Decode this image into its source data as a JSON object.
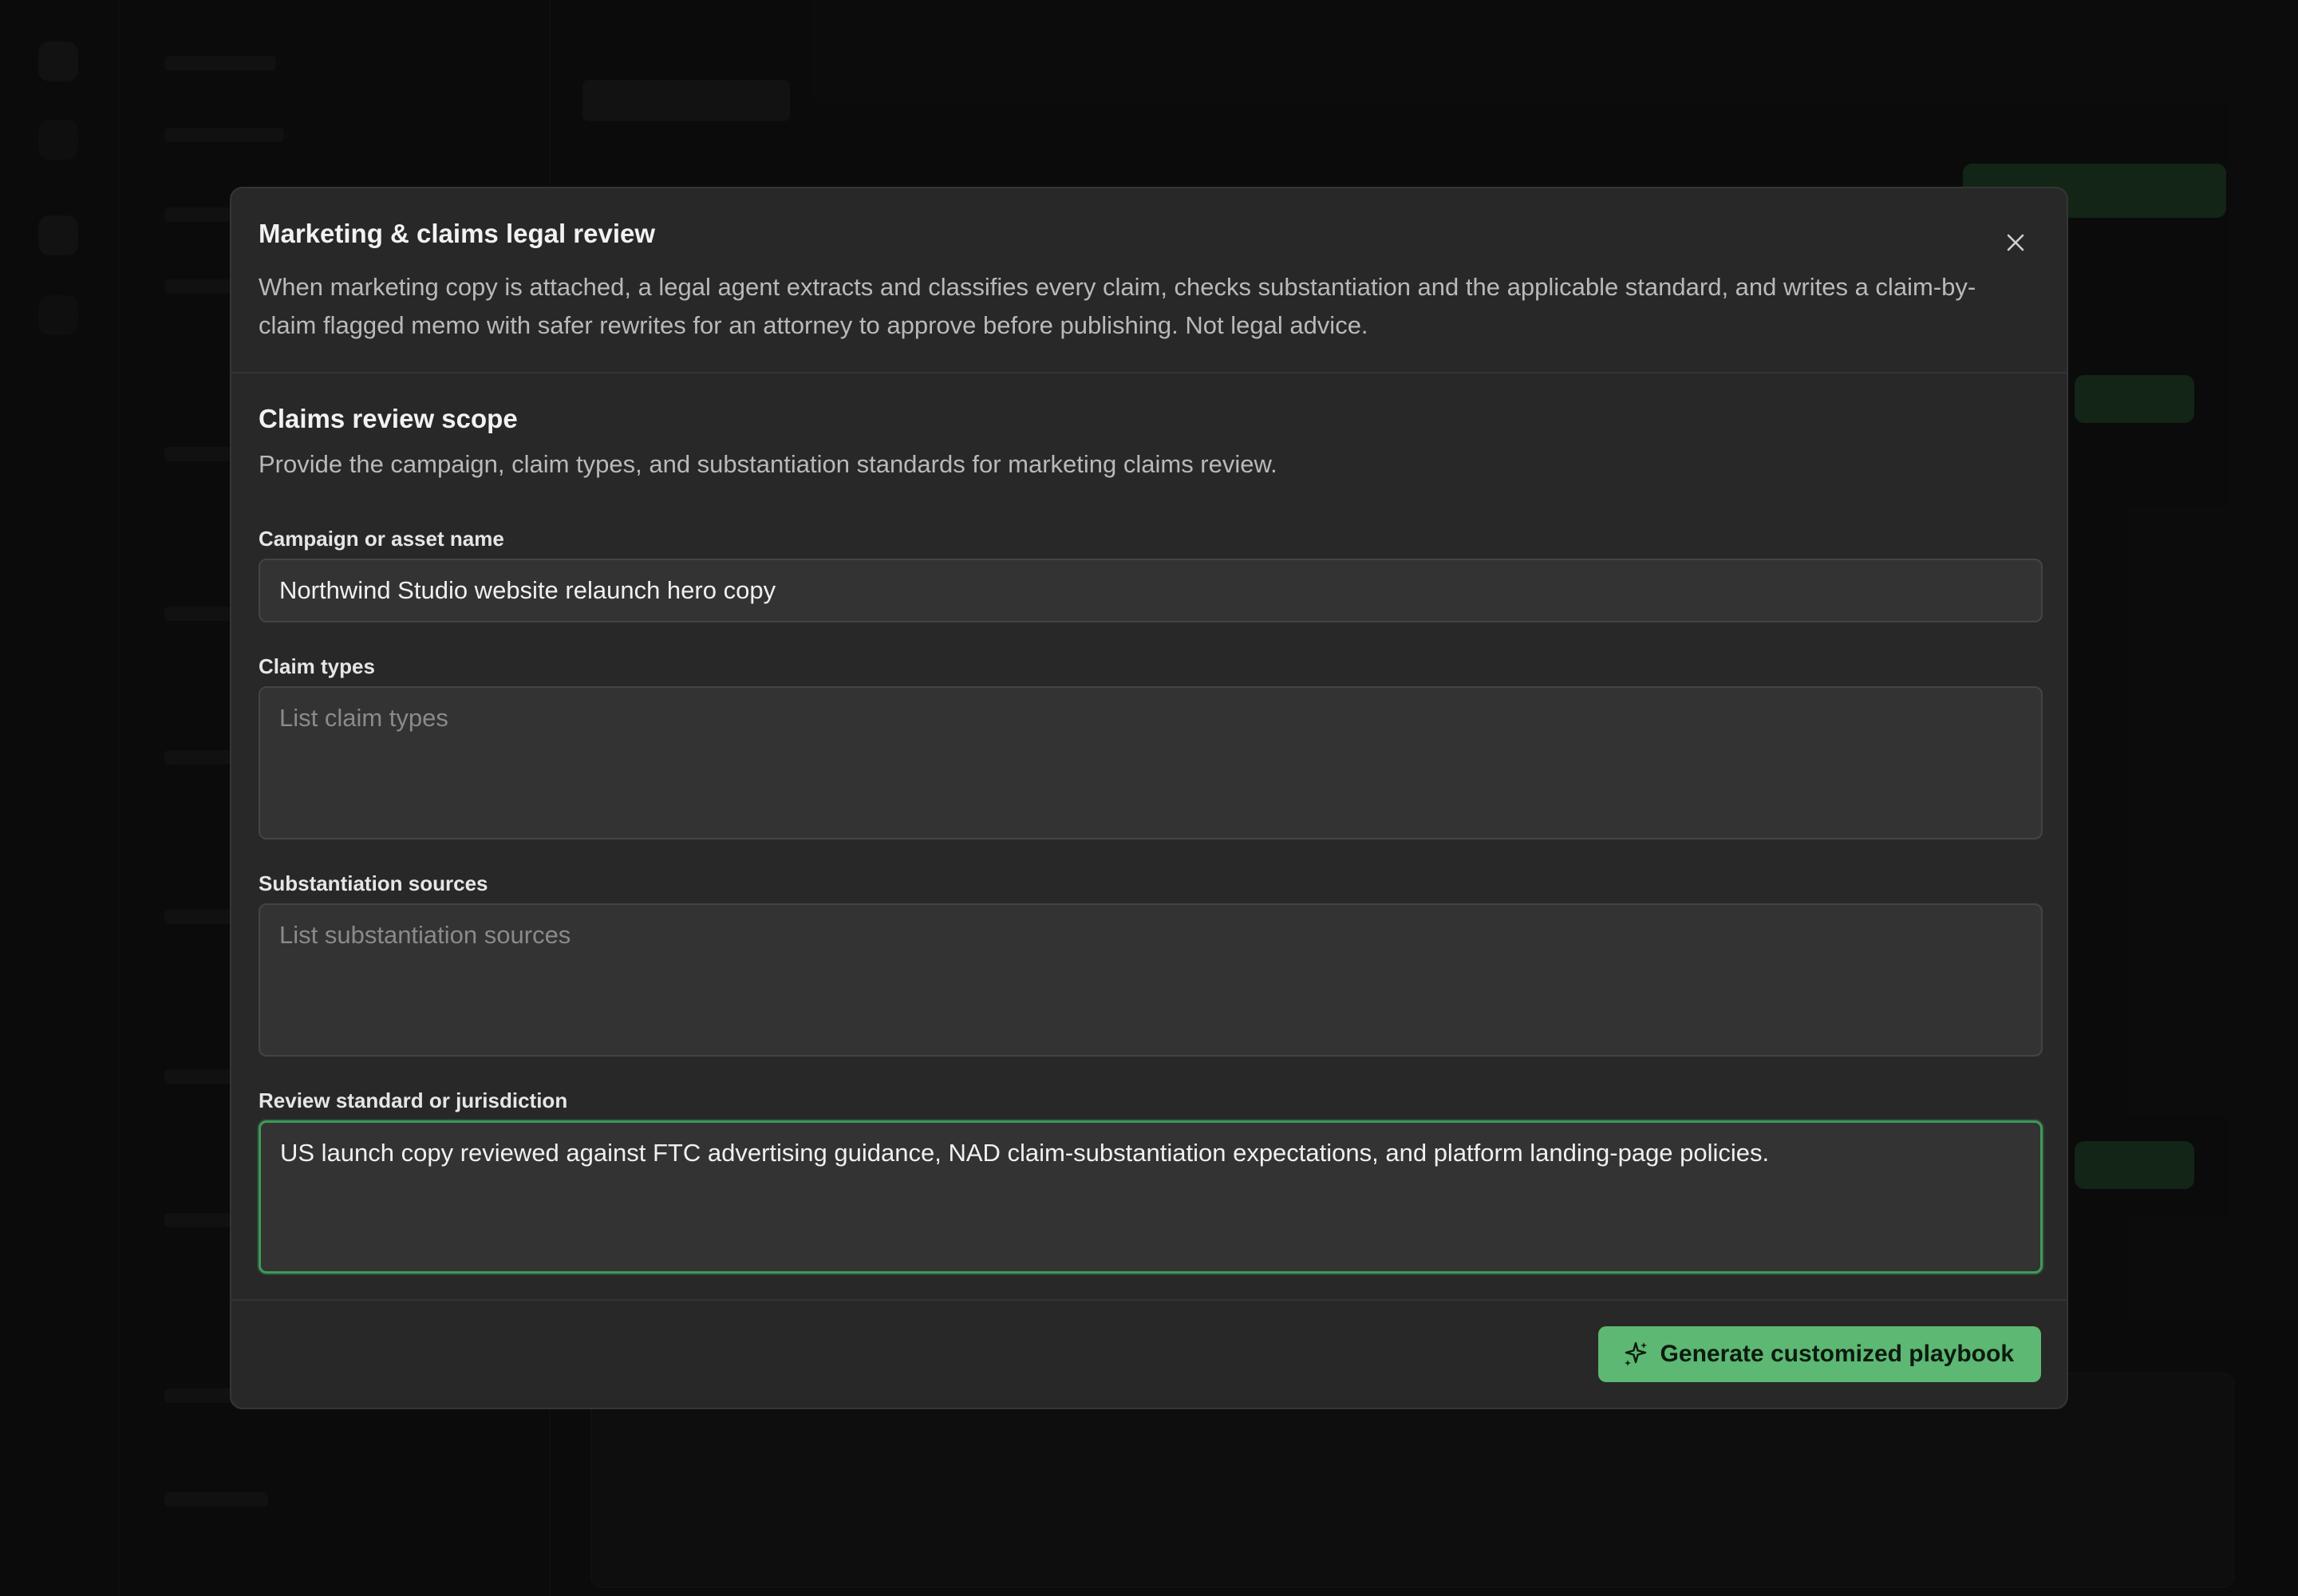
{
  "modal": {
    "title": "Marketing & claims legal review",
    "description": "When marketing copy is attached, a legal agent extracts and classifies every claim, checks substantiation and the applicable standard, and writes a claim-by-claim flagged memo with safer rewrites for an attorney to approve before publishing. Not legal advice.",
    "close_icon": "close-icon"
  },
  "section": {
    "title": "Claims review scope",
    "description": "Provide the campaign, claim types, and substantiation standards for marketing claims review."
  },
  "fields": {
    "campaign": {
      "label": "Campaign or asset name",
      "value": "Northwind Studio website relaunch hero copy",
      "placeholder": ""
    },
    "claim_types": {
      "label": "Claim types",
      "value": "",
      "placeholder": "List claim types"
    },
    "substantiation": {
      "label": "Substantiation sources",
      "value": "",
      "placeholder": "List substantiation sources"
    },
    "review_standard": {
      "label": "Review standard or jurisdiction",
      "value": "US launch copy reviewed against FTC advertising guidance, NAD claim-substantiation expectations, and platform landing-page policies.",
      "placeholder": ""
    }
  },
  "footer": {
    "generate_label": "Generate customized playbook",
    "generate_icon": "sparkles-icon"
  },
  "colors": {
    "accent": "#5cb872",
    "focus_border": "#3f9a5a",
    "modal_bg": "#282828"
  }
}
